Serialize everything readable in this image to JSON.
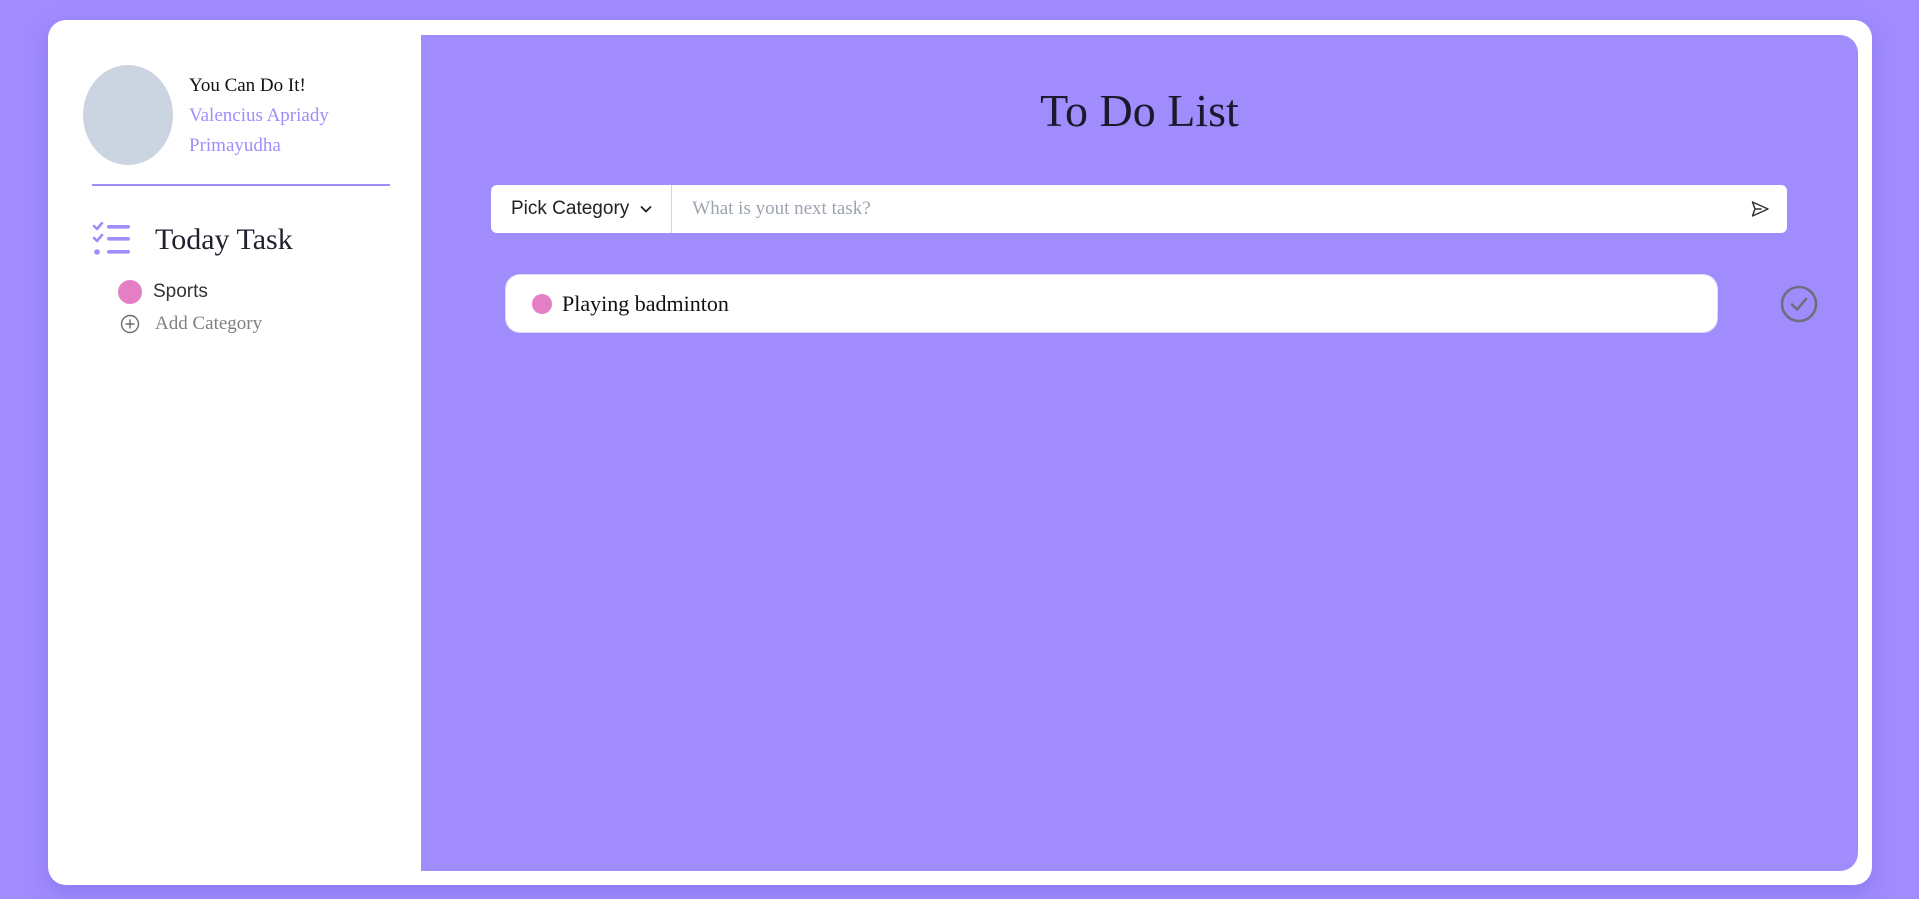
{
  "sidebar": {
    "profile": {
      "motto": "You Can Do It!",
      "name": "Valencius Apriady Primayudha"
    },
    "today": {
      "title": "Today Task",
      "icon": "checklist-icon"
    },
    "categories": [
      {
        "label": "Sports",
        "color": "#e57fc5"
      }
    ],
    "add_category": {
      "label": "Add Category",
      "icon": "plus-circle-icon"
    }
  },
  "main": {
    "title": "To Do List",
    "form": {
      "category_select_label": "Pick Category",
      "task_placeholder": "What is yout next task?",
      "send_icon": "send-icon"
    },
    "tasks": [
      {
        "text": "Playing badminton",
        "category_color": "#e57fc5"
      }
    ]
  },
  "colors": {
    "accent": "#a18cfe",
    "sports": "#e57fc5",
    "avatar": "#cbd5e1"
  }
}
